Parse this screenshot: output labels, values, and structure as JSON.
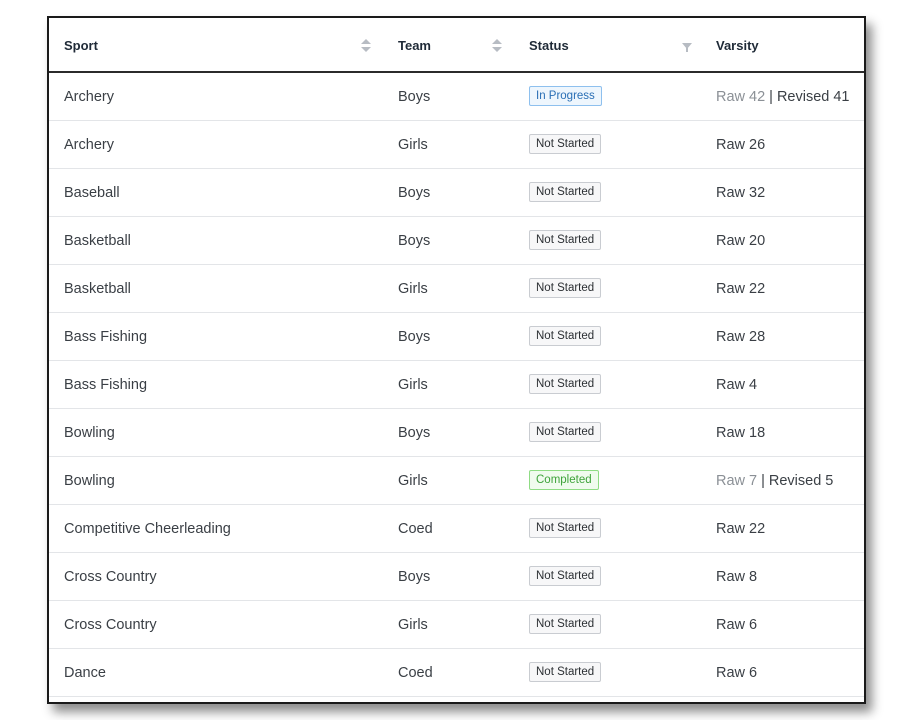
{
  "table": {
    "columns": {
      "sport": "Sport",
      "team": "Team",
      "status": "Status",
      "varsity": "Varsity"
    },
    "rows": [
      {
        "sport": "Archery",
        "team": "Boys",
        "status": "In Progress",
        "status_kind": "progress",
        "raw": "Raw 42",
        "revised": "Revised 41"
      },
      {
        "sport": "Archery",
        "team": "Girls",
        "status": "Not Started",
        "status_kind": "default",
        "raw": "Raw 26",
        "revised": null
      },
      {
        "sport": "Baseball",
        "team": "Boys",
        "status": "Not Started",
        "status_kind": "default",
        "raw": "Raw 32",
        "revised": null
      },
      {
        "sport": "Basketball",
        "team": "Boys",
        "status": "Not Started",
        "status_kind": "default",
        "raw": "Raw 20",
        "revised": null
      },
      {
        "sport": "Basketball",
        "team": "Girls",
        "status": "Not Started",
        "status_kind": "default",
        "raw": "Raw 22",
        "revised": null
      },
      {
        "sport": "Bass Fishing",
        "team": "Boys",
        "status": "Not Started",
        "status_kind": "default",
        "raw": "Raw 28",
        "revised": null
      },
      {
        "sport": "Bass Fishing",
        "team": "Girls",
        "status": "Not Started",
        "status_kind": "default",
        "raw": "Raw 4",
        "revised": null
      },
      {
        "sport": "Bowling",
        "team": "Boys",
        "status": "Not Started",
        "status_kind": "default",
        "raw": "Raw 18",
        "revised": null
      },
      {
        "sport": "Bowling",
        "team": "Girls",
        "status": "Completed",
        "status_kind": "completed",
        "raw": "Raw 7",
        "revised": "Revised 5"
      },
      {
        "sport": "Competitive Cheerleading",
        "team": "Coed",
        "status": "Not Started",
        "status_kind": "default",
        "raw": "Raw 22",
        "revised": null
      },
      {
        "sport": "Cross Country",
        "team": "Boys",
        "status": "Not Started",
        "status_kind": "default",
        "raw": "Raw 8",
        "revised": null
      },
      {
        "sport": "Cross Country",
        "team": "Girls",
        "status": "Not Started",
        "status_kind": "default",
        "raw": "Raw 6",
        "revised": null
      },
      {
        "sport": "Dance",
        "team": "Coed",
        "status": "Not Started",
        "status_kind": "default",
        "raw": "Raw 6",
        "revised": null
      }
    ],
    "separator": "|"
  },
  "icons": {
    "sport_sort": "sort-icon",
    "team_sort": "sort-icon",
    "status_filter": "filter-icon"
  },
  "colors": {
    "in_progress": "#2a6fb5",
    "completed": "#3ea33a",
    "not_started": "#2b2f33"
  }
}
